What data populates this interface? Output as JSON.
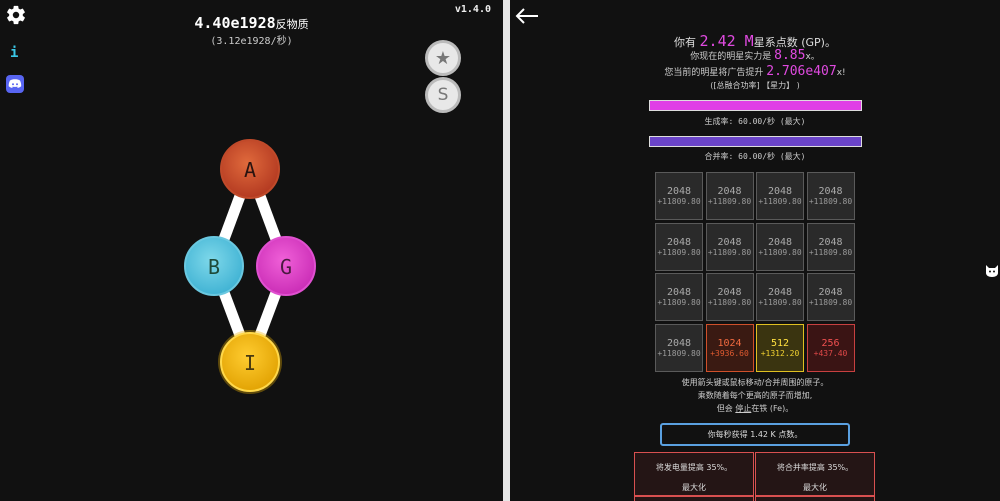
{
  "left": {
    "version": "v1.4.0",
    "amount": "4.40e1928",
    "amount_unit": "反物质",
    "rate": "(3.12e1928/秒)",
    "info_text": "i",
    "s_button": "S",
    "star_button": "★",
    "nodes": [
      {
        "id": "A",
        "label": "A",
        "color": "#c9432a"
      },
      {
        "id": "B",
        "label": "B",
        "color": "#4ec5e0"
      },
      {
        "id": "G",
        "label": "G",
        "color": "#e040c8"
      },
      {
        "id": "I",
        "label": "I",
        "color": "#f2b400"
      }
    ]
  },
  "right": {
    "gp_prefix": "你有",
    "gp_value": "2.42 M",
    "gp_suffix": "星系点数 (GP)。",
    "strength_prefix": "你现在的明星实力是",
    "strength_value": "8.85",
    "strength_suffix": "x。",
    "boost_prefix": "您当前的明星将广告提升",
    "boost_value": "2.706e407",
    "boost_suffix": "x!",
    "total_line": "([总融合功率] 【星力】 )",
    "gen_label": "生成率:  60.00/秒 (最大)",
    "merge_label": "合并率:  60.00/秒 (最大)",
    "gen_color": "#e040e6",
    "merge_color": "#6a44c8",
    "cells": [
      {
        "value": "2048",
        "bonus": "+11809.80",
        "style": "gray"
      },
      {
        "value": "2048",
        "bonus": "+11809.80",
        "style": "gray"
      },
      {
        "value": "2048",
        "bonus": "+11809.80",
        "style": "gray"
      },
      {
        "value": "2048",
        "bonus": "+11809.80",
        "style": "gray"
      },
      {
        "value": "2048",
        "bonus": "+11809.80",
        "style": "gray"
      },
      {
        "value": "2048",
        "bonus": "+11809.80",
        "style": "gray"
      },
      {
        "value": "2048",
        "bonus": "+11809.80",
        "style": "gray"
      },
      {
        "value": "2048",
        "bonus": "+11809.80",
        "style": "gray"
      },
      {
        "value": "2048",
        "bonus": "+11809.80",
        "style": "gray"
      },
      {
        "value": "2048",
        "bonus": "+11809.80",
        "style": "gray"
      },
      {
        "value": "2048",
        "bonus": "+11809.80",
        "style": "gray"
      },
      {
        "value": "2048",
        "bonus": "+11809.80",
        "style": "gray"
      },
      {
        "value": "2048",
        "bonus": "+11809.80",
        "style": "gray"
      },
      {
        "value": "1024",
        "bonus": "+3936.60",
        "style": "orange"
      },
      {
        "value": "512",
        "bonus": "+1312.20",
        "style": "yellow"
      },
      {
        "value": "256",
        "bonus": "+437.40",
        "style": "red"
      }
    ],
    "note1": "使用箭头键或鼠标移动/合并周围的原子。",
    "note2": "乘数随着每个更高的原子而增加,",
    "note3_a": "但会",
    "note3_link": "停止",
    "note3_b": "在铁 (Fe)。",
    "earn_text": "你每秒获得 1.42 K 点数。",
    "upgrade1_title": "将发电量提高 35%。",
    "upgrade1_state": "最大化",
    "upgrade2_title": "将合并率提高 35%。",
    "upgrade2_state": "最大化"
  }
}
